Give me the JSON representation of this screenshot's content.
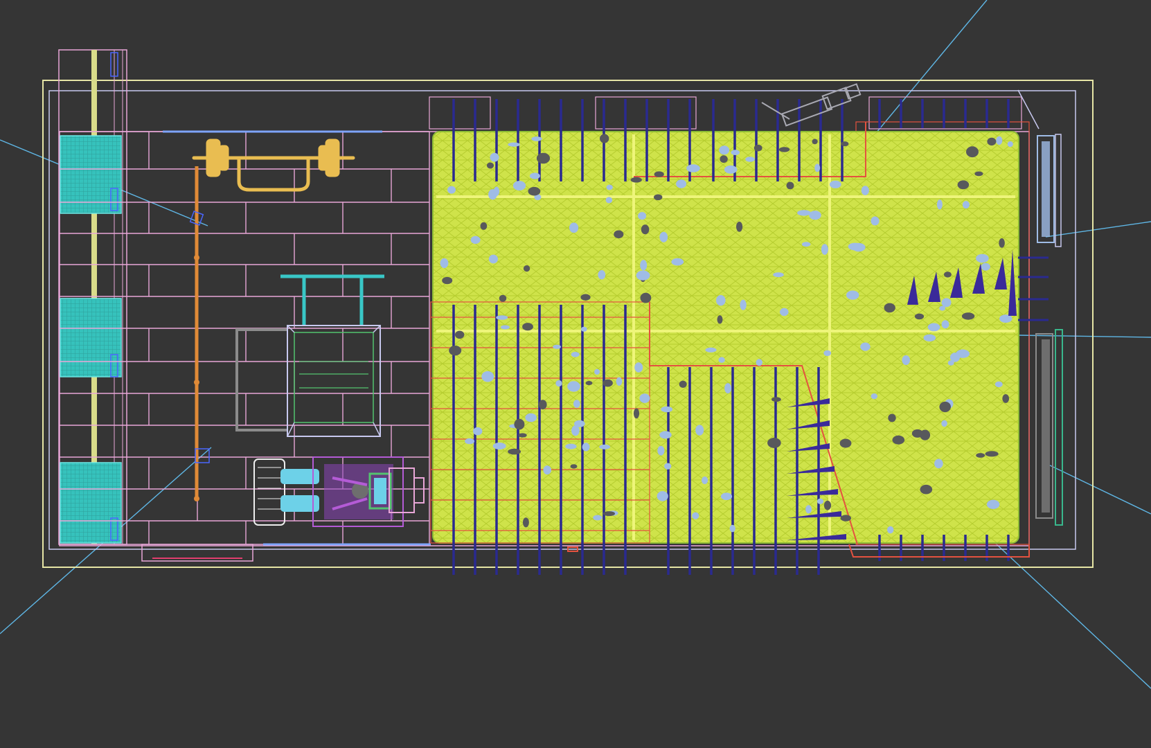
{
  "viewport": {
    "name": "top-view-wireframe",
    "background": "#353535"
  },
  "colors": {
    "outline": "#e7e6a6",
    "wall": "#c8c9f0",
    "brick": "#e9a7d8",
    "floor_mesh": "#d8eb4e",
    "climbing_wall_line": "#2a2a90",
    "orange_track": "#e08a37",
    "red_edge": "#e4523f",
    "cyan_panel": "#39c7c7",
    "camera_line": "#5fb7e6",
    "barbell": "#e9bd51",
    "rowing_machine": "#b45bd6",
    "seat": "#6dd1e8",
    "gray_frame": "#8c8c8c",
    "green_frame": "#53c36f",
    "hold_blue": "#9fbce6",
    "hold_dark": "#58595c"
  },
  "icons": {
    "barbell": "barbell-icon",
    "rowing_machine": "rowing-machine-icon",
    "camera_target": "camera-target-icon"
  }
}
